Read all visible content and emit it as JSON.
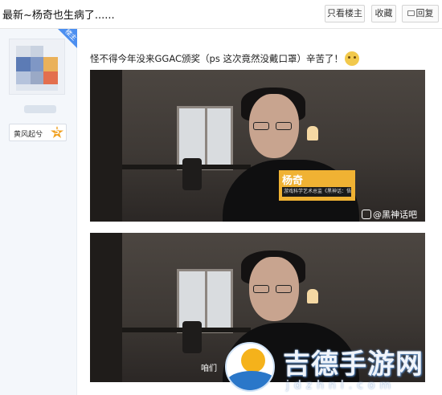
{
  "header": {
    "title": "最新~杨奇也生病了......",
    "buttons": {
      "only_op": "只看楼主",
      "favorite": "收藏",
      "reply": "回复"
    }
  },
  "author": {
    "badge": "楼主",
    "level_name": "黄风起兮",
    "level_number": "5"
  },
  "post": {
    "text": "怪不得今年没来GGAC颁奖（ps 这次竟然没戴口罩）辛苦了！",
    "emoji": "emoji-sweat-icon",
    "image1": {
      "name_tag": "杨奇",
      "name_tag_sub": "游戏科学艺术总监《黑神话：悟空》美术总监",
      "watermark": "@黑神话吧"
    },
    "image2": {
      "subtitle": "咱们"
    }
  },
  "site_watermark": {
    "name": "吉德手游网",
    "url": "jdzhnl.com"
  },
  "colors": {
    "badge": "#4c8ff0",
    "name_tag": "#f0b233",
    "level_star": "#f0a020",
    "logo_blue": "#2a77c9",
    "logo_sun": "#f5b21b"
  }
}
